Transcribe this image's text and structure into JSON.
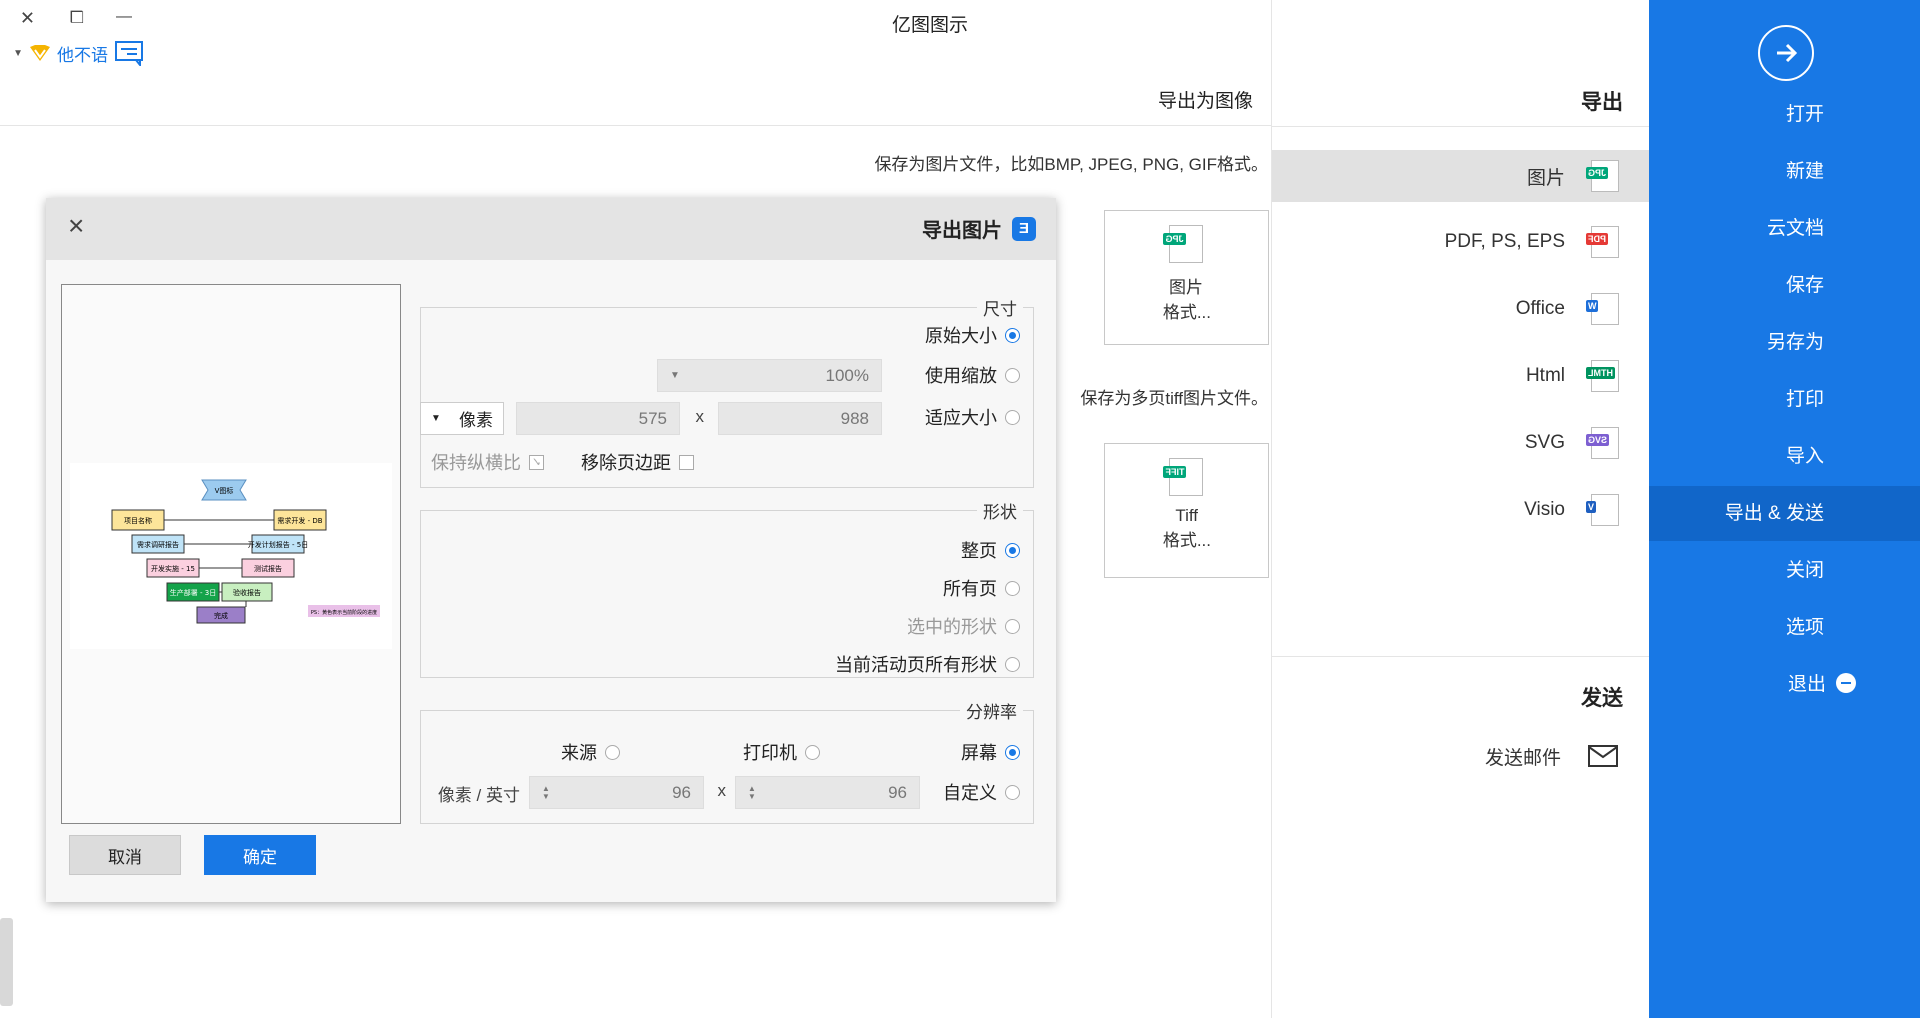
{
  "window": {
    "title": "亿图图示",
    "user": "他不语"
  },
  "sidebar": {
    "items": [
      {
        "label": "打开"
      },
      {
        "label": "新建"
      },
      {
        "label": "云文档"
      },
      {
        "label": "保存"
      },
      {
        "label": "另存为"
      },
      {
        "label": "打印"
      },
      {
        "label": "导入"
      },
      {
        "label": "导出 & 发送"
      },
      {
        "label": "关闭"
      },
      {
        "label": "选项"
      },
      {
        "label": "退出"
      }
    ],
    "active_index": 7
  },
  "export": {
    "heading": "导出",
    "formats": [
      {
        "label": "图片",
        "badge": "JPG",
        "color": "#00a67a"
      },
      {
        "label": "PDF, PS, EPS",
        "badge": "PDF",
        "color": "#e53935"
      },
      {
        "label": "Office",
        "badge": "W",
        "color": "#1e6fd9"
      },
      {
        "label": "Html",
        "badge": "HTML",
        "color": "#00935f"
      },
      {
        "label": "SVG",
        "badge": "SVG",
        "color": "#7d5fd1"
      },
      {
        "label": "Visio",
        "badge": "V",
        "color": "#1e5fc0"
      }
    ],
    "send_heading": "发送",
    "send_email": "发送邮件"
  },
  "main": {
    "heading": "导出为图像",
    "desc1": "保存为图片文件，比如BMP, JPEG, PNG, GIF格式。",
    "card1": {
      "line1": "图片",
      "line2": "格式...",
      "badge": "JPG"
    },
    "desc2": "保存为多页tiff图片文件。",
    "card2": {
      "line1": "Tiff",
      "line2": "格式...",
      "badge": "TIFF"
    }
  },
  "dialog": {
    "title": "导出图片",
    "size": {
      "legend": "尺寸",
      "original": "原始大小",
      "zoom": "使用缩放",
      "zoom_value": "100%",
      "fit": "适应大小",
      "width": "988",
      "height": "575",
      "x": "x",
      "unit": "像素",
      "remove_margin": "移除页边距",
      "keep_ratio": "保持纵横比"
    },
    "shape": {
      "legend": "形状",
      "whole": "整页",
      "all": "所有页",
      "selected": "选中的形状",
      "current": "当前活动页所有形状"
    },
    "resolution": {
      "legend": "分辨率",
      "screen": "屏幕",
      "printer": "打印机",
      "source": "来源",
      "custom": "自定义",
      "dpi_x": "96",
      "dpi_y": "96",
      "x": "x",
      "unit": "像素 / 英寸"
    },
    "ok": "确定",
    "cancel": "取消",
    "preview": {
      "nodes": [
        "V图标",
        "项目名称",
        "需求开发 - DB",
        "需求调研报告",
        "开发计划报告 - 5日",
        "开发实施 - 15",
        "测试报告",
        "生产部署 - 3日",
        "验收报告",
        "完成",
        "PS：黄色表示当前阶段的进度"
      ]
    }
  }
}
